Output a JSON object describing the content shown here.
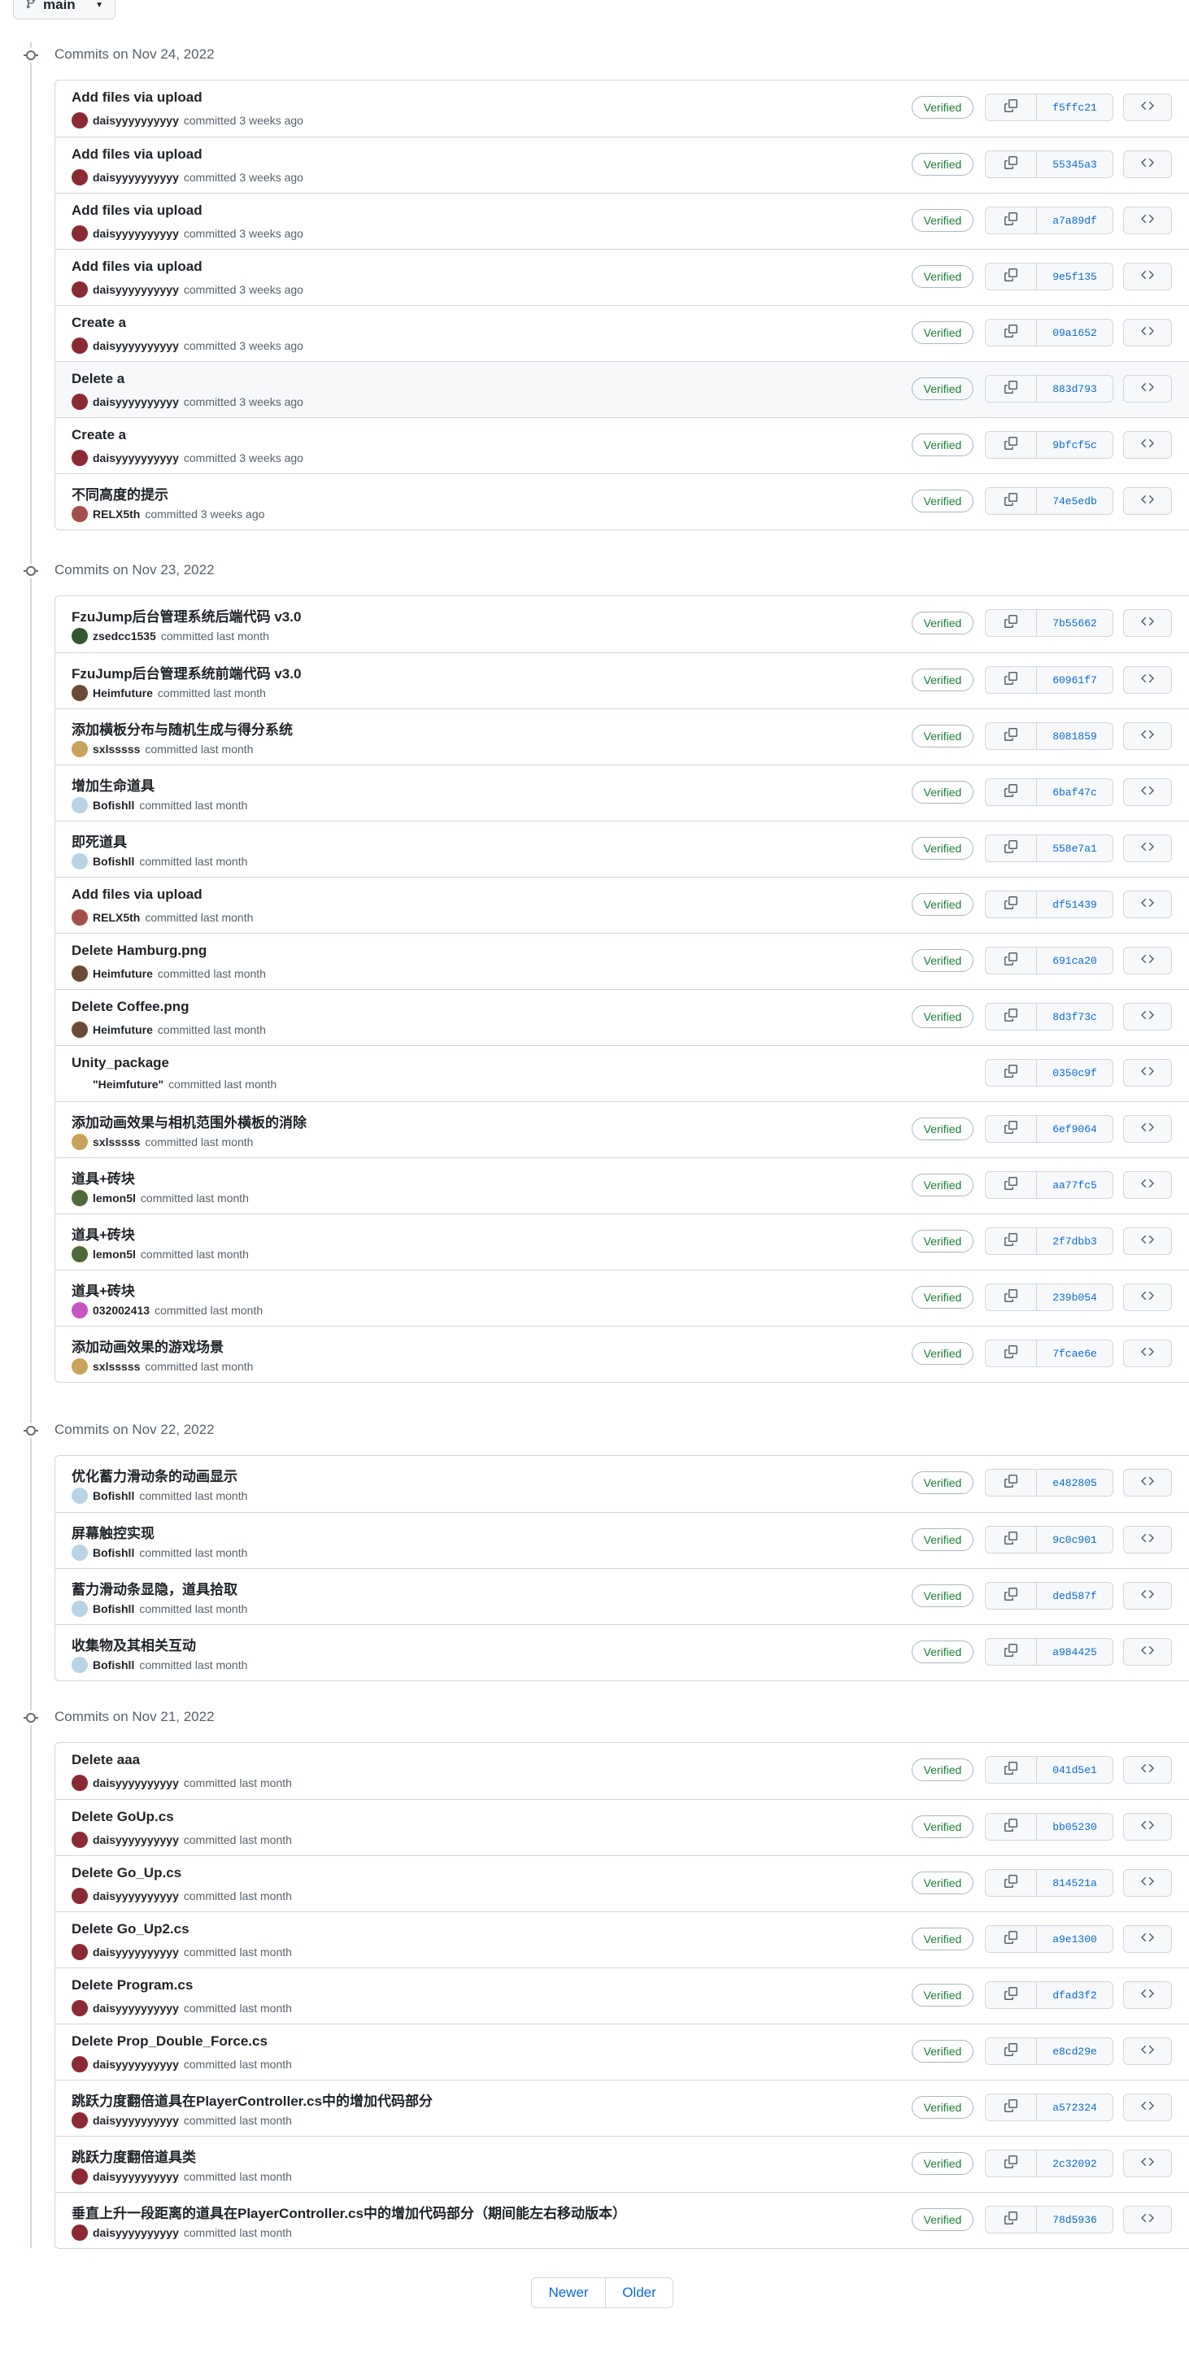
{
  "branch": {
    "label": "main"
  },
  "verified_label": "Verified",
  "pagination": {
    "newer": "Newer",
    "older": "Older"
  },
  "groups": [
    {
      "title": "Commits on Nov 24, 2022",
      "commits": [
        {
          "message": "Add files via upload",
          "author": "daisyyyyyyyyyy",
          "action": "committed 3 weeks ago",
          "sha": "f5ffc21",
          "verified": true,
          "avatar_color": "#8a2a33"
        },
        {
          "message": "Add files via upload",
          "author": "daisyyyyyyyyyy",
          "action": "committed 3 weeks ago",
          "sha": "55345a3",
          "verified": true,
          "avatar_color": "#8a2a33"
        },
        {
          "message": "Add files via upload",
          "author": "daisyyyyyyyyyy",
          "action": "committed 3 weeks ago",
          "sha": "a7a89df",
          "verified": true,
          "avatar_color": "#8a2a33"
        },
        {
          "message": "Add files via upload",
          "author": "daisyyyyyyyyyy",
          "action": "committed 3 weeks ago",
          "sha": "9e5f135",
          "verified": true,
          "avatar_color": "#8a2a33"
        },
        {
          "message": "Create a",
          "author": "daisyyyyyyyyyy",
          "action": "committed 3 weeks ago",
          "sha": "09a1652",
          "verified": true,
          "avatar_color": "#8a2a33"
        },
        {
          "message": "Delete a",
          "author": "daisyyyyyyyyyy",
          "action": "committed 3 weeks ago",
          "sha": "883d793",
          "verified": true,
          "avatar_color": "#8a2a33"
        },
        {
          "message": "Create a",
          "author": "daisyyyyyyyyyy",
          "action": "committed 3 weeks ago",
          "sha": "9bfcf5c",
          "verified": true,
          "avatar_color": "#8a2a33"
        },
        {
          "message": "不同高度的提示",
          "author": "RELX5th",
          "action": "committed 3 weeks ago",
          "sha": "74e5edb",
          "verified": true,
          "avatar_color": "#a4504a"
        }
      ]
    },
    {
      "title": "Commits on Nov 23, 2022",
      "commits": [
        {
          "message": "FzuJump后台管理系统后端代码 v3.0",
          "author": "zsedcc1535",
          "action": "committed last month",
          "sha": "7b55662",
          "verified": true,
          "avatar_color": "#2f5a2f"
        },
        {
          "message": "FzuJump后台管理系统前端代码 v3.0",
          "author": "Heimfuture",
          "action": "committed last month",
          "sha": "60961f7",
          "verified": true,
          "avatar_color": "#6a4a34"
        },
        {
          "message": "添加横板分布与随机生成与得分系统",
          "author": "sxlsssss",
          "action": "committed last month",
          "sha": "8081859",
          "verified": true,
          "avatar_color": "#c9a35a"
        },
        {
          "message": "增加生命道具",
          "author": "Bofishll",
          "action": "committed last month",
          "sha": "6baf47c",
          "verified": true,
          "avatar_color": "#b9d3e6"
        },
        {
          "message": "即死道具",
          "author": "Bofishll",
          "action": "committed last month",
          "sha": "558e7a1",
          "verified": true,
          "avatar_color": "#b9d3e6"
        },
        {
          "message": "Add files via upload",
          "author": "RELX5th",
          "action": "committed last month",
          "sha": "df51439",
          "verified": true,
          "avatar_color": "#a4504a"
        },
        {
          "message": "Delete Hamburg.png",
          "author": "Heimfuture",
          "action": "committed last month",
          "sha": "691ca20",
          "verified": true,
          "avatar_color": "#6a4a34"
        },
        {
          "message": "Delete Coffee.png",
          "author": "Heimfuture",
          "action": "committed last month",
          "sha": "8d3f73c",
          "verified": true,
          "avatar_color": "#6a4a34"
        },
        {
          "message": "Unity_package",
          "author": "\"Heimfuture\"",
          "action": "committed last month",
          "sha": "0350c9f",
          "verified": false,
          "avatar_color": ""
        },
        {
          "message": "添加动画效果与相机范围外横板的消除",
          "author": "sxlsssss",
          "action": "committed last month",
          "sha": "6ef9064",
          "verified": true,
          "avatar_color": "#c9a35a"
        },
        {
          "message": "道具+砖块",
          "author": "lemon5l",
          "action": "committed last month",
          "sha": "aa77fc5",
          "verified": true,
          "avatar_color": "#4d6a3a"
        },
        {
          "message": "道具+砖块",
          "author": "lemon5l",
          "action": "committed last month",
          "sha": "2f7dbb3",
          "verified": true,
          "avatar_color": "#4d6a3a"
        },
        {
          "message": "道具+砖块",
          "author": "032002413",
          "action": "committed last month",
          "sha": "239b054",
          "verified": true,
          "avatar_color": "#c555c0"
        },
        {
          "message": "添加动画效果的游戏场景",
          "author": "sxlsssss",
          "action": "committed last month",
          "sha": "7fcae6e",
          "verified": true,
          "avatar_color": "#c9a35a"
        }
      ]
    },
    {
      "title": "Commits on Nov 22, 2022",
      "commits": [
        {
          "message": "优化蓄力滑动条的动画显示",
          "author": "Bofishll",
          "action": "committed last month",
          "sha": "e482805",
          "verified": true,
          "avatar_color": "#b9d3e6"
        },
        {
          "message": "屏幕触控实现",
          "author": "Bofishll",
          "action": "committed last month",
          "sha": "9c0c901",
          "verified": true,
          "avatar_color": "#b9d3e6"
        },
        {
          "message": "蓄力滑动条显隐，道具拾取",
          "author": "Bofishll",
          "action": "committed last month",
          "sha": "ded587f",
          "verified": true,
          "avatar_color": "#b9d3e6"
        },
        {
          "message": "收集物及其相关互动",
          "author": "Bofishll",
          "action": "committed last month",
          "sha": "a984425",
          "verified": true,
          "avatar_color": "#b9d3e6"
        }
      ]
    },
    {
      "title": "Commits on Nov 21, 2022",
      "commits": [
        {
          "message": "Delete aaa",
          "author": "daisyyyyyyyyyy",
          "action": "committed last month",
          "sha": "041d5e1",
          "verified": true,
          "avatar_color": "#8a2a33"
        },
        {
          "message": "Delete GoUp.cs",
          "author": "daisyyyyyyyyyy",
          "action": "committed last month",
          "sha": "bb05230",
          "verified": true,
          "avatar_color": "#8a2a33"
        },
        {
          "message": "Delete Go_Up.cs",
          "author": "daisyyyyyyyyyy",
          "action": "committed last month",
          "sha": "814521a",
          "verified": true,
          "avatar_color": "#8a2a33"
        },
        {
          "message": "Delete Go_Up2.cs",
          "author": "daisyyyyyyyyyy",
          "action": "committed last month",
          "sha": "a9e1300",
          "verified": true,
          "avatar_color": "#8a2a33"
        },
        {
          "message": "Delete Program.cs",
          "author": "daisyyyyyyyyyy",
          "action": "committed last month",
          "sha": "dfad3f2",
          "verified": true,
          "avatar_color": "#8a2a33"
        },
        {
          "message": "Delete Prop_Double_Force.cs",
          "author": "daisyyyyyyyyyy",
          "action": "committed last month",
          "sha": "e8cd29e",
          "verified": true,
          "avatar_color": "#8a2a33"
        },
        {
          "message": "跳跃力度翻倍道具在PlayerController.cs中的增加代码部分",
          "author": "daisyyyyyyyyyy",
          "action": "committed last month",
          "sha": "a572324",
          "verified": true,
          "avatar_color": "#8a2a33"
        },
        {
          "message": "跳跃力度翻倍道具类",
          "author": "daisyyyyyyyyyy",
          "action": "committed last month",
          "sha": "2c32092",
          "verified": true,
          "avatar_color": "#8a2a33"
        },
        {
          "message": "垂直上升一段距离的道具在PlayerController.cs中的增加代码部分（期间能左右移动版本）",
          "author": "daisyyyyyyyyyy",
          "action": "committed last month",
          "sha": "78d5936",
          "verified": true,
          "avatar_color": "#8a2a33"
        }
      ]
    }
  ]
}
